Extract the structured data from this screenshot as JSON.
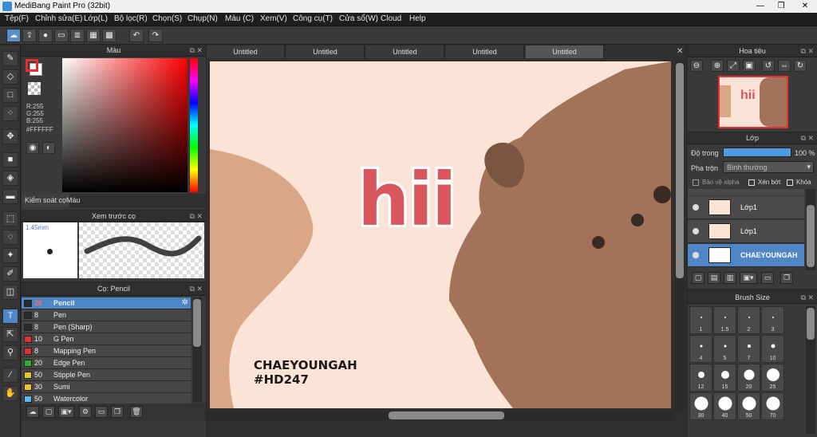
{
  "window": {
    "title": "MediBang Paint Pro (32bit)",
    "minimize": "—",
    "maximize": "❐",
    "close": "✕"
  },
  "menu": [
    "Tệp(F)",
    "Chỉnh sửa(E)",
    "Lớp(L)",
    "Bộ lọc(R)",
    "Chọn(S)",
    "Chụp(N)",
    "Màu (C)",
    "Xem(V)",
    "Công cụ(T)",
    "Cửa sổ(W)",
    "Cloud",
    "Help"
  ],
  "toolbar_icons": [
    "cloud-icon",
    "export-icon",
    "speech-icon",
    "comment-icon",
    "page-icon",
    "grid-icon",
    "tiles-icon",
    "undo-icon",
    "redo-icon"
  ],
  "tools": [
    "brush-icon",
    "eraser-icon",
    "rectangle-icon",
    "dots-icon",
    "move-icon",
    "fill-rect-icon",
    "bucket-icon",
    "gradient-icon",
    "select-rect-icon",
    "lasso-icon",
    "magic-wand-icon",
    "select-pen-icon",
    "select-eraser-icon",
    "text-icon",
    "operation-icon",
    "eyedropper-icon",
    "pen-knife-icon",
    "hand-icon"
  ],
  "color_panel": {
    "title": "Màu",
    "r": "R:255",
    "g": "G:255",
    "b": "B:255",
    "hex": "#FFFFFF",
    "primary": "#e52f2f",
    "tabs": [
      "Kiểm soát cọ",
      "Màu"
    ]
  },
  "brush_preview": {
    "title": "Xem trước cọ",
    "size": "1.45mm"
  },
  "brush_panel": {
    "title": "Cọ: Pencil",
    "items": [
      {
        "size": "20",
        "name": "Pencil",
        "color": "#2b2b2b"
      },
      {
        "size": "8",
        "name": "Pen",
        "color": "#2b2b2b"
      },
      {
        "size": "8",
        "name": "Pen (Sharp)",
        "color": "#2b2b2b"
      },
      {
        "size": "10",
        "name": "G Pen",
        "color": "#e03030"
      },
      {
        "size": "8",
        "name": "Mapping Pen",
        "color": "#e03030"
      },
      {
        "size": "20",
        "name": "Edge Pen",
        "color": "#2fae2f"
      },
      {
        "size": "50",
        "name": "Stipple Pen",
        "color": "#e6c81e"
      },
      {
        "size": "30",
        "name": "Sumi",
        "color": "#e6c81e"
      },
      {
        "size": "50",
        "name": "Watercolor",
        "color": "#5bb8f0"
      }
    ]
  },
  "doc_tabs": [
    "Untitled",
    "Untitled",
    "Untitled",
    "Untitled",
    "Untitled"
  ],
  "canvas": {
    "art_text": "hii",
    "sig_line1": "CHAEYOUNGAH",
    "sig_line2": "#HD247"
  },
  "navigator": {
    "title": "Hoa tiêu"
  },
  "layers": {
    "title": "Lớp",
    "opacity_label": "Độ trong",
    "opacity_value": "100 %",
    "blend_label": "Pha trộn",
    "blend_value": "Bình thường",
    "alpha_lock": "Bảo vệ alpha",
    "clipping": "Xén bớt",
    "lock": "Khóa",
    "items": [
      {
        "name": "Lớp1"
      },
      {
        "name": "Lớp1"
      },
      {
        "name": "CHAEYOUNGAH"
      }
    ]
  },
  "brush_size": {
    "title": "Brush Size",
    "sizes": [
      "1",
      "1.5",
      "2",
      "3",
      "4",
      "5",
      "7",
      "10",
      "12",
      "15",
      "20",
      "25",
      "30",
      "40",
      "50",
      "70"
    ]
  }
}
